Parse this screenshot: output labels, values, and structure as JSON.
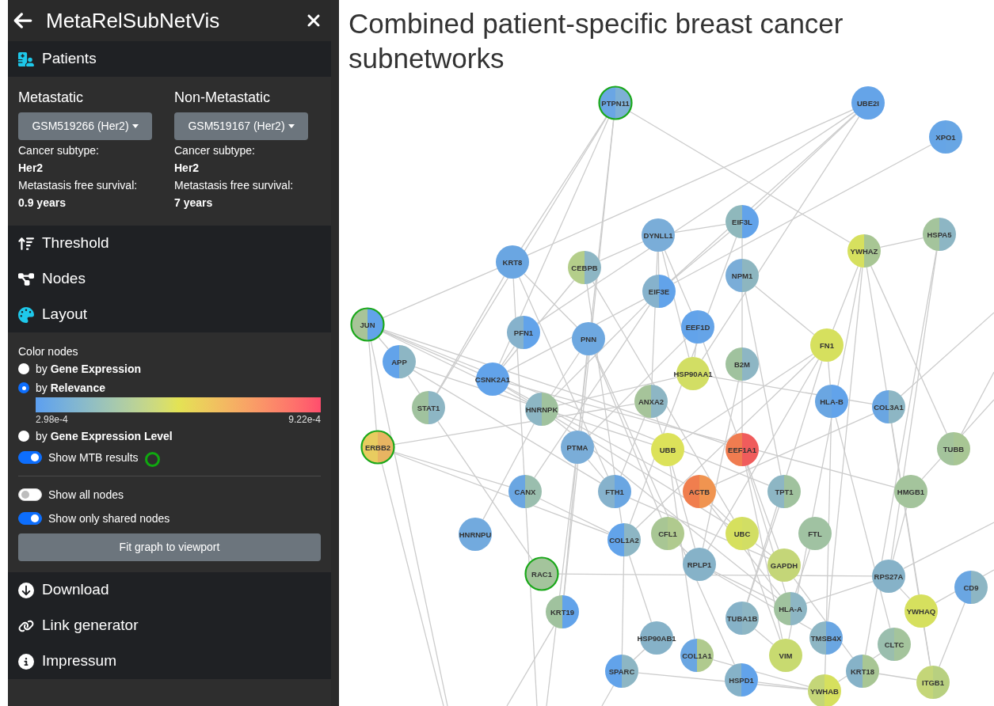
{
  "app_title": "MetaRelSubNetVis",
  "sections": [
    {
      "label": "Patients",
      "kind": "patients",
      "expanded": true
    },
    {
      "label": "Threshold",
      "kind": "threshold",
      "expanded": false
    },
    {
      "label": "Nodes",
      "kind": "nodes",
      "expanded": false
    },
    {
      "label": "Layout",
      "kind": "layout",
      "expanded": true
    },
    {
      "label": "Download",
      "kind": "download",
      "expanded": false
    },
    {
      "label": "Link generator",
      "kind": "link",
      "expanded": false
    },
    {
      "label": "Impressum",
      "kind": "info",
      "expanded": false
    }
  ],
  "patients": [
    {
      "heading": "Metastatic",
      "sample": "GSM519266 (Her2)",
      "subtype_label": "Cancer subtype:",
      "subtype": "Her2",
      "survival_label": "Metastasis free survival:",
      "survival": "0.9 years"
    },
    {
      "heading": "Non-Metastatic",
      "sample": "GSM519167 (Her2)",
      "subtype_label": "Cancer subtype:",
      "subtype": "Her2",
      "survival_label": "Metastasis free survival:",
      "survival": "7 years"
    }
  ],
  "layout": {
    "color_nodes_label": "Color nodes",
    "options": [
      {
        "text": "by **Gene Expression**",
        "selected": false
      },
      {
        "text": "by **Relevance**",
        "selected": true,
        "legend_min": "2.98e-4",
        "legend_max": "9.22e-4"
      },
      {
        "text": "by **Gene Expression Level**",
        "selected": false
      }
    ],
    "toggles": [
      {
        "label": "Show MTB results",
        "on": true,
        "kind": "mtb"
      },
      {
        "label": "Show all nodes",
        "on": false,
        "kind": "plain"
      },
      {
        "label": "Show only shared nodes",
        "on": true,
        "kind": "plain"
      }
    ],
    "fit_button": "Fit graph to viewport"
  },
  "graph": {
    "title": "Combined patient-specific breast cancer subnetworks",
    "nodes": [
      {
        "label": "PTPN11",
        "halves": [
          {
            "color": "#6aa6e4"
          },
          {
            "color": "#7eb0d6"
          }
        ],
        "mtb": true
      },
      {
        "label": "UBE2I",
        "halves": [
          {
            "color": "#65a4e8"
          },
          {
            "color": "#65a4e8"
          }
        ],
        "mtb": false
      },
      {
        "label": "XPO1",
        "halves": [
          {
            "color": "#66a5e6"
          },
          {
            "color": "#68a6e4"
          }
        ],
        "mtb": false
      },
      {
        "label": "EIF3L",
        "halves": [
          {
            "color": "#8fb8bc"
          },
          {
            "color": "#62a3ea"
          }
        ],
        "mtb": false
      },
      {
        "label": "DYNLL1",
        "halves": [
          {
            "color": "#7aadd8"
          },
          {
            "color": "#7aadd8"
          }
        ],
        "mtb": false
      },
      {
        "label": "HSPA5",
        "halves": [
          {
            "color": "#a4c49c"
          },
          {
            "color": "#8db6c4"
          }
        ],
        "mtb": false
      },
      {
        "label": "YWHAZ",
        "halves": [
          {
            "color": "#d6e05e"
          },
          {
            "color": "#a8c694"
          }
        ],
        "mtb": false
      },
      {
        "label": "KRT8",
        "halves": [
          {
            "color": "#6aa6e2"
          },
          {
            "color": "#6aa6e2"
          }
        ],
        "mtb": false
      },
      {
        "label": "CEBPB",
        "halves": [
          {
            "color": "#b4ce8a"
          },
          {
            "color": "#8db6c4"
          }
        ],
        "mtb": false
      },
      {
        "label": "NPM1",
        "halves": [
          {
            "color": "#7aadd8"
          },
          {
            "color": "#8db6c0"
          }
        ],
        "mtb": false
      },
      {
        "label": "EIF3E",
        "halves": [
          {
            "color": "#86b2cc"
          },
          {
            "color": "#62a3ea"
          }
        ],
        "mtb": false
      },
      {
        "label": "JUN",
        "halves": [
          {
            "color": "#a8c498"
          },
          {
            "color": "#62a3ea"
          }
        ],
        "mtb": true
      },
      {
        "label": "PFN1",
        "halves": [
          {
            "color": "#86b2cc"
          },
          {
            "color": "#62a3ea"
          }
        ],
        "mtb": false
      },
      {
        "label": "PNN",
        "halves": [
          {
            "color": "#6ea8e0"
          },
          {
            "color": "#6ea8e0"
          }
        ],
        "mtb": false
      },
      {
        "label": "EEF1D",
        "halves": [
          {
            "color": "#62a3ea"
          },
          {
            "color": "#65a4e8"
          }
        ],
        "mtb": false
      },
      {
        "label": "FN1",
        "halves": [
          {
            "color": "#d6e05e"
          },
          {
            "color": "#d6e05e"
          }
        ],
        "mtb": false
      },
      {
        "label": "APP",
        "halves": [
          {
            "color": "#62a3ea"
          },
          {
            "color": "#8db6c4"
          }
        ],
        "mtb": false
      },
      {
        "label": "CSNK2A1",
        "halves": [
          {
            "color": "#62a3ea"
          },
          {
            "color": "#62a3ea"
          }
        ],
        "mtb": false
      },
      {
        "label": "HSP90AA1",
        "halves": [
          {
            "color": "#d2de64"
          },
          {
            "color": "#d2de64"
          }
        ],
        "mtb": false
      },
      {
        "label": "B2M",
        "halves": [
          {
            "color": "#a0c29e"
          },
          {
            "color": "#8db6c4"
          }
        ],
        "mtb": false
      },
      {
        "label": "STAT1",
        "halves": [
          {
            "color": "#a0c29e"
          },
          {
            "color": "#8db6c4"
          }
        ],
        "mtb": false
      },
      {
        "label": "HNRNPK",
        "halves": [
          {
            "color": "#8db6c4"
          },
          {
            "color": "#a0c29e"
          }
        ],
        "mtb": false
      },
      {
        "label": "ANXA2",
        "halves": [
          {
            "color": "#a6c49a"
          },
          {
            "color": "#8db6c4"
          }
        ],
        "mtb": false
      },
      {
        "label": "HLA-B",
        "halves": [
          {
            "color": "#6aa6e2"
          },
          {
            "color": "#62a3ea"
          }
        ],
        "mtb": false
      },
      {
        "label": "COL3A1",
        "halves": [
          {
            "color": "#6aa6e2"
          },
          {
            "color": "#8db6c4"
          }
        ],
        "mtb": false
      },
      {
        "label": "ERBB2",
        "halves": [
          {
            "color": "#e8cc60"
          },
          {
            "color": "#e8b462"
          }
        ],
        "mtb": true
      },
      {
        "label": "PTMA",
        "halves": [
          {
            "color": "#7aadd8"
          },
          {
            "color": "#7aadd8"
          }
        ],
        "mtb": false
      },
      {
        "label": "UBB",
        "halves": [
          {
            "color": "#dce25a"
          },
          {
            "color": "#dce25a"
          }
        ],
        "mtb": false
      },
      {
        "label": "EEF1A1",
        "halves": [
          {
            "color": "#f07c50"
          },
          {
            "color": "#f05c5c"
          }
        ],
        "mtb": false
      },
      {
        "label": "TUBB",
        "halves": [
          {
            "color": "#a4c49c"
          },
          {
            "color": "#a8c694"
          }
        ],
        "mtb": false
      },
      {
        "label": "CANX",
        "halves": [
          {
            "color": "#6aa6e2"
          },
          {
            "color": "#9abeae"
          }
        ],
        "mtb": false
      },
      {
        "label": "FTH1",
        "halves": [
          {
            "color": "#86b2cc"
          },
          {
            "color": "#6aa6e2"
          }
        ],
        "mtb": false
      },
      {
        "label": "ACTB",
        "halves": [
          {
            "color": "#f07e4e"
          },
          {
            "color": "#f09450"
          }
        ],
        "mtb": false
      },
      {
        "label": "TPT1",
        "halves": [
          {
            "color": "#8db6c4"
          },
          {
            "color": "#a0c29e"
          }
        ],
        "mtb": false
      },
      {
        "label": "HMGB1",
        "halves": [
          {
            "color": "#a4c49c"
          },
          {
            "color": "#a4c49c"
          }
        ],
        "mtb": false
      },
      {
        "label": "HNRNPU",
        "halves": [
          {
            "color": "#72aade"
          },
          {
            "color": "#72aade"
          }
        ],
        "mtb": false
      },
      {
        "label": "COL1A2",
        "halves": [
          {
            "color": "#62a3ea"
          },
          {
            "color": "#8db6c4"
          }
        ],
        "mtb": false
      },
      {
        "label": "CFL1",
        "halves": [
          {
            "color": "#a8c694"
          },
          {
            "color": "#b0ca8e"
          }
        ],
        "mtb": false
      },
      {
        "label": "UBC",
        "halves": [
          {
            "color": "#d6e05e"
          },
          {
            "color": "#d2de64"
          }
        ],
        "mtb": false
      },
      {
        "label": "FTL",
        "halves": [
          {
            "color": "#a0c2a2"
          },
          {
            "color": "#a0c2a2"
          }
        ],
        "mtb": false
      },
      {
        "label": "RAC1",
        "halves": [
          {
            "color": "#a4c49c"
          },
          {
            "color": "#a4c49c"
          }
        ],
        "mtb": true
      },
      {
        "label": "RPLP1",
        "halves": [
          {
            "color": "#86b2c8"
          },
          {
            "color": "#86b2c8"
          }
        ],
        "mtb": false
      },
      {
        "label": "GAPDH",
        "halves": [
          {
            "color": "#c4d678"
          },
          {
            "color": "#c4d678"
          }
        ],
        "mtb": false
      },
      {
        "label": "RPS27A",
        "halves": [
          {
            "color": "#86b2c8"
          },
          {
            "color": "#86b2c8"
          }
        ],
        "mtb": false
      },
      {
        "label": "CD9",
        "halves": [
          {
            "color": "#6aa6e2"
          },
          {
            "color": "#8db6c4"
          }
        ],
        "mtb": false
      },
      {
        "label": "KRT19",
        "halves": [
          {
            "color": "#a0c29e"
          },
          {
            "color": "#62a3ea"
          }
        ],
        "mtb": false
      },
      {
        "label": "HLA-A",
        "halves": [
          {
            "color": "#a0c29e"
          },
          {
            "color": "#8db6c4"
          }
        ],
        "mtb": false
      },
      {
        "label": "YWHAQ",
        "halves": [
          {
            "color": "#d6e05e"
          },
          {
            "color": "#d6e05e"
          }
        ],
        "mtb": false
      },
      {
        "label": "TUBA1B",
        "halves": [
          {
            "color": "#86b2c8"
          },
          {
            "color": "#8db6c4"
          }
        ],
        "mtb": false
      },
      {
        "label": "HSP90AB1",
        "halves": [
          {
            "color": "#86b2c8"
          },
          {
            "color": "#86b2c8"
          }
        ],
        "mtb": false
      },
      {
        "label": "TMSB4X",
        "halves": [
          {
            "color": "#8db6c4"
          },
          {
            "color": "#6aa6e2"
          }
        ],
        "mtb": false
      },
      {
        "label": "CLTC",
        "halves": [
          {
            "color": "#9abeae"
          },
          {
            "color": "#a4c49c"
          }
        ],
        "mtb": false
      },
      {
        "label": "COL1A1",
        "halves": [
          {
            "color": "#6aa6e2"
          },
          {
            "color": "#b0ca8e"
          }
        ],
        "mtb": false
      },
      {
        "label": "VIM",
        "halves": [
          {
            "color": "#c8da70"
          },
          {
            "color": "#c8da70"
          }
        ],
        "mtb": false
      },
      {
        "label": "SPARC",
        "halves": [
          {
            "color": "#62a3ea"
          },
          {
            "color": "#8db6c4"
          }
        ],
        "mtb": false
      },
      {
        "label": "KRT18",
        "halves": [
          {
            "color": "#86b2c8"
          },
          {
            "color": "#a8c694"
          }
        ],
        "mtb": false
      },
      {
        "label": "HSPD1",
        "halves": [
          {
            "color": "#86b2c8"
          },
          {
            "color": "#62a3ea"
          }
        ],
        "mtb": false
      },
      {
        "label": "ITGB1",
        "halves": [
          {
            "color": "#c4d678"
          },
          {
            "color": "#b8d080"
          }
        ],
        "mtb": false
      },
      {
        "label": "YWHAB",
        "halves": [
          {
            "color": "#c4d678"
          },
          {
            "color": "#d6e05e"
          }
        ],
        "mtb": false
      }
    ]
  }
}
